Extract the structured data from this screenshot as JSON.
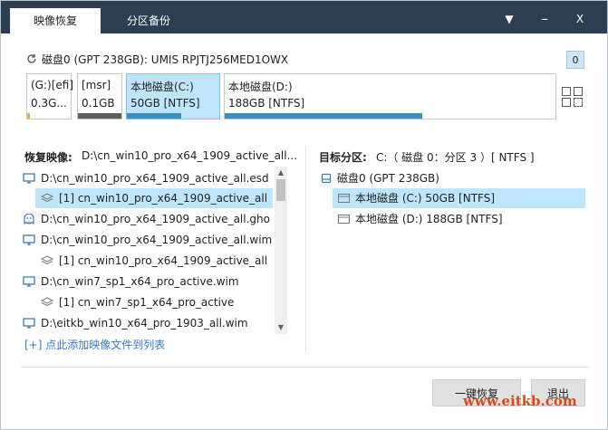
{
  "tabs": [
    {
      "label": "映像恢复",
      "active": true
    },
    {
      "label": "分区备份",
      "active": false
    }
  ],
  "window_controls": {
    "dropdown": "▼",
    "close": "X"
  },
  "disk": {
    "title": "磁盘0 (GPT 238GB): UMIS RPJTJ256MED1OWX",
    "count": "0",
    "partitions": [
      {
        "name": "(G:)[efi]",
        "size": "0.3G...",
        "bar_color": "#f0a860",
        "fill": 0.05
      },
      {
        "name": "[msr]",
        "size": "0.1GB",
        "bar_color": "#606060",
        "fill": 1.0
      },
      {
        "name": "本地磁盘(C:)",
        "size": "50GB [NTFS]",
        "bar_color": "#3a8fc4",
        "fill": 0.6,
        "selected": true
      },
      {
        "name": "本地磁盘(D:)",
        "size": "188GB [NTFS]",
        "bar_color": "#3a8fc4",
        "fill": 0.6
      }
    ]
  },
  "restore": {
    "label": "恢复映像:",
    "value": "D:\\cn_win10_pro_x64_1909_active_all...",
    "items": [
      {
        "text": "D:\\cn_win10_pro_x64_1909_active_all.esd",
        "icon": "monitor-icon",
        "level": 0
      },
      {
        "text": "[1] cn_win10_pro_x64_1909_active_all",
        "icon": "layers-icon",
        "level": 1,
        "selected": true
      },
      {
        "text": "D:\\cn_win10_pro_x64_1909_active_all.gho",
        "icon": "ghost-icon",
        "level": 0
      },
      {
        "text": "D:\\cn_win10_pro_x64_1909_active_all.wim",
        "icon": "monitor-icon",
        "level": 0
      },
      {
        "text": "[1] cn_win10_pro_x64_1909_active_all",
        "icon": "layers-icon",
        "level": 1
      },
      {
        "text": "D:\\cn_win7_sp1_x64_pro_active.wim",
        "icon": "monitor-icon",
        "level": 0
      },
      {
        "text": "[1] cn_win7_sp1_x64_pro_active",
        "icon": "layers-icon",
        "level": 1
      },
      {
        "text": "D:\\eitkb_win10_x64_pro_1903_all.wim",
        "icon": "monitor-icon",
        "level": 0
      }
    ],
    "add_link": "[+] 点此添加映像文件到列表"
  },
  "target": {
    "label": "目标分区:",
    "value": "C:（ 磁盘 0：分区 3 ）[ NTFS ]",
    "tree": [
      {
        "text": "磁盘0 (GPT 238GB)",
        "icon": "disk-icon",
        "level": 0
      },
      {
        "text": "本地磁盘 (C:) 50GB [NTFS]",
        "icon": "partition-icon",
        "level": 1,
        "selected": true
      },
      {
        "text": "本地磁盘 (D:) 188GB [NTFS]",
        "icon": "partition-icon",
        "level": 1
      }
    ]
  },
  "buttons": {
    "restore": "一键恢复",
    "exit": "退出"
  },
  "watermark": "www.eitkb.com"
}
